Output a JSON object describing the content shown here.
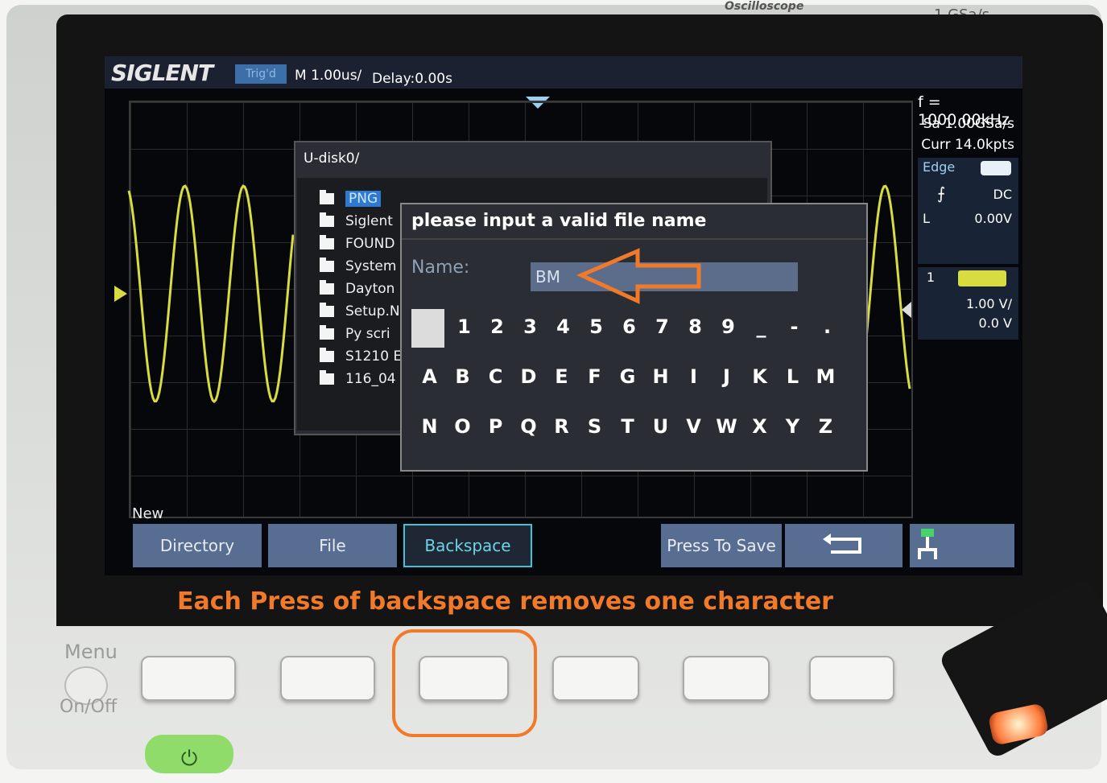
{
  "bezel": {
    "model_text": "Oscilloscope",
    "sample_spec": "1 GSa/s"
  },
  "header": {
    "brand": "SIGLENT",
    "trigger_status": "Trig'd",
    "timebase": "M 1.00us/",
    "delay": "Delay:0.00s"
  },
  "right_panel": {
    "frequency": "f = 1000.00kHz",
    "sample_rate": "Sa 1.00GSa/s",
    "memory": "Curr 14.0kpts",
    "trigger_type": "Edge",
    "trigger_coupling": "DC",
    "trigger_level_label": "L",
    "trigger_level": "0.00V",
    "channel_number": "1",
    "channel_scale": "1.00 V/",
    "channel_offset": "0.0 V"
  },
  "file_browser": {
    "path": "U-disk0/",
    "items": [
      {
        "label": "PNG",
        "selected": true
      },
      {
        "label": "Siglent",
        "selected": false
      },
      {
        "label": "FOUND",
        "selected": false
      },
      {
        "label": "System",
        "selected": false
      },
      {
        "label": "Dayton",
        "selected": false
      },
      {
        "label": "Setup.N",
        "selected": false
      },
      {
        "label": "Py scri",
        "selected": false
      },
      {
        "label": "S1210 E",
        "selected": false
      },
      {
        "label": "116_04",
        "selected": false
      }
    ]
  },
  "dialog": {
    "title": "please input a valid file name",
    "name_label": "Name:",
    "name_value": "BM",
    "keyboard": {
      "row1": [
        "1",
        "2",
        "3",
        "4",
        "5",
        "6",
        "7",
        "8",
        "9",
        "_",
        "-",
        "."
      ],
      "row2": [
        "A",
        "B",
        "C",
        "D",
        "E",
        "F",
        "G",
        "H",
        "I",
        "J",
        "K",
        "L",
        "M"
      ],
      "row3": [
        "N",
        "O",
        "P",
        "Q",
        "R",
        "S",
        "T",
        "U",
        "V",
        "W",
        "X",
        "Y",
        "Z"
      ]
    }
  },
  "softkey_bar": {
    "section_label": "New",
    "keys": [
      {
        "label": "Directory",
        "active": false
      },
      {
        "label": "File",
        "active": false
      },
      {
        "label": "Backspace",
        "active": true
      },
      {
        "label": "Press To Save",
        "active": false
      }
    ],
    "return_icon": "return-arrow-icon",
    "usb_icon": "usb-network-icon"
  },
  "panel": {
    "menu_label": "Menu",
    "onoff_label": "On/Off"
  },
  "annotation": {
    "caption": "Each Press of backspace removes one character",
    "color": "#f07a2a"
  },
  "colors": {
    "waveform": "#d8dc40",
    "screen_bg": "#05070a",
    "softkey": "#586d92",
    "active_border": "#3fc3d8"
  }
}
